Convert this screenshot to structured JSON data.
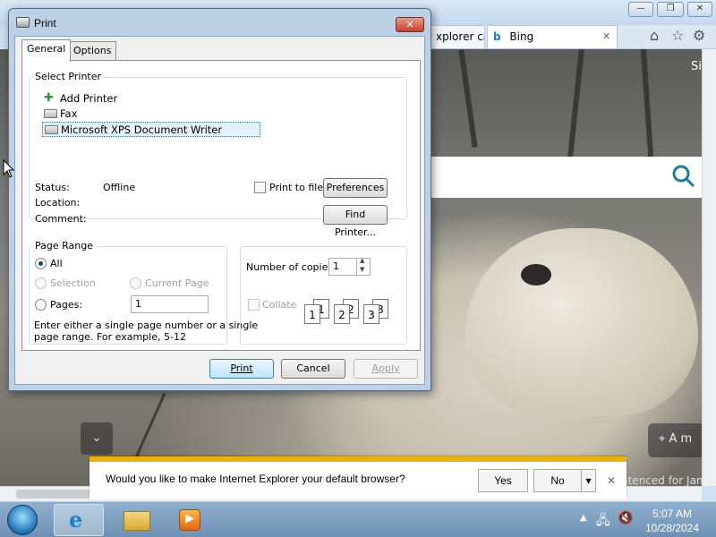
{
  "print_dialog": {
    "title": "Print",
    "close_label": "✕",
    "tabs": [
      "General",
      "Options"
    ],
    "select_printer": {
      "legend": "Select Printer",
      "printers": [
        "Add Printer",
        "Fax",
        "Microsoft XPS Document Writer"
      ],
      "selected": "Microsoft XPS Document Writer",
      "status_label": "Status:",
      "status_value": "Offline",
      "location_label": "Location:",
      "comment_label": "Comment:",
      "print_to_file_label": "Print to file",
      "preferences_label": "Preferences",
      "find_printer_label": "Find Printer..."
    },
    "page_range": {
      "legend": "Page Range",
      "all_label": "All",
      "selection_label": "Selection",
      "current_page_label": "Current Page",
      "pages_label": "Pages:",
      "pages_value": "1",
      "help_line1": "Enter either a single page number or a single",
      "help_line2": "page range.  For example, 5-12"
    },
    "copies": {
      "label": "Number of copies:",
      "value": "1",
      "collate_label": "Collate",
      "collate_pages": [
        "1",
        "1",
        "2",
        "2",
        "3",
        "3"
      ]
    },
    "buttons": {
      "print": "Print",
      "cancel": "Cancel",
      "apply": "Apply"
    }
  },
  "browser": {
    "tab_partial": "xplorer ca...",
    "tab_bing": "Bing",
    "tab_close": "✕",
    "right_edge_text": "Si",
    "location_snippet": "A m",
    "bottom_right_snippet": "ntenced for Jan",
    "search_icon": "search-icon",
    "window_controls": [
      "—",
      "❐",
      "✕"
    ],
    "toolbar_icons": [
      "home-icon",
      "star-icon",
      "gear-icon"
    ]
  },
  "notification": {
    "message": "Would you like to make Internet Explorer your default browser?",
    "yes": "Yes",
    "no": "No",
    "dropdown": "▾",
    "close": "✕",
    "accent_color": "#f0b000"
  },
  "taskbar": {
    "time": "5:07 AM",
    "date": "10/28/2024",
    "items": [
      "start-orb",
      "internet-explorer-icon",
      "file-explorer-icon",
      "media-player-icon"
    ]
  }
}
